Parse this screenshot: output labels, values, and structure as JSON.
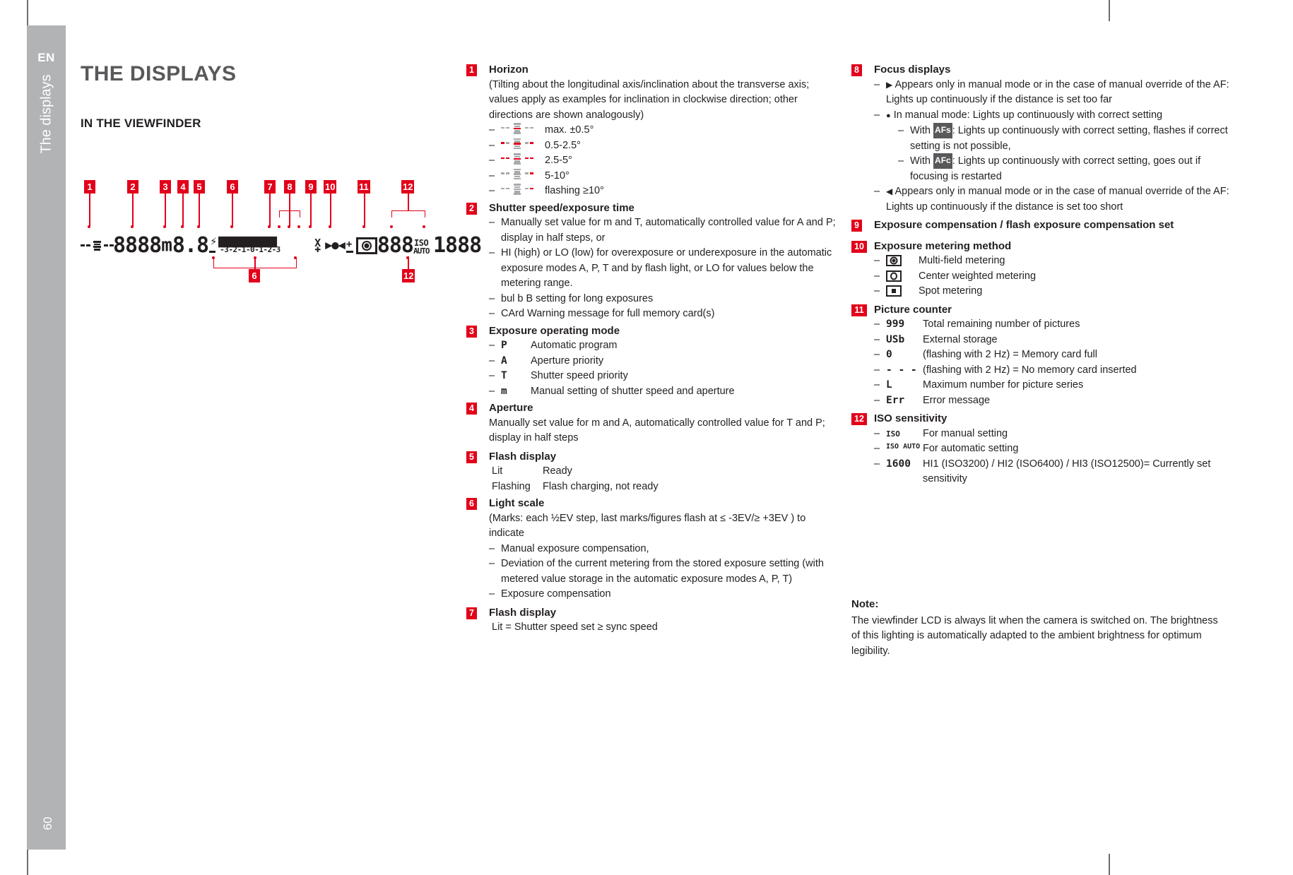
{
  "sidebar": {
    "language": "EN",
    "chapter": "The displays",
    "page_number": "60"
  },
  "headings": {
    "h1": "THE DISPLAYS",
    "h2": "IN THE VIEWFINDER"
  },
  "diagram": {
    "lcd_segments": "-- -- 8888 m 8.8 ⚡ |||||||||||| X ▶●◀ ± ◎ 888 ISO/AUTO 1888",
    "scale_ticks": "-3-2-1-0-1-2-3",
    "callouts": [
      "1",
      "2",
      "3",
      "4",
      "5",
      "6",
      "7",
      "8",
      "9",
      "10",
      "11",
      "12"
    ],
    "lower_callouts": [
      "6",
      "12"
    ]
  },
  "column1": [
    {
      "num": "1",
      "title": "Horizon",
      "intro": "(Tilting about the longitudinal axis/inclination about the transverse axis; values apply as examples for inclination in clockwise direction; other directions are shown analogously)",
      "items": [
        {
          "icon": "horizon-level-0",
          "text": "max. ±0.5°"
        },
        {
          "icon": "horizon-level-1",
          "text": "0.5-2.5°"
        },
        {
          "icon": "horizon-level-2",
          "text": "2.5-5°"
        },
        {
          "icon": "horizon-level-3",
          "text": "5-10°"
        },
        {
          "icon": "horizon-level-4",
          "text": "flashing ≥10°"
        }
      ]
    },
    {
      "num": "2",
      "title": "Shutter speed/exposure time",
      "items": [
        {
          "text": "Manually set value for m and T, automatically controlled value for A and P; display in half steps, or"
        },
        {
          "text": "HI (high) or LO (low) for overexposure or underexposure in the automatic exposure modes A, P, T and by flash light, or LO for values below the metering range."
        },
        {
          "text": "bul b B setting for long exposures"
        },
        {
          "text": "CArd Warning message for full memory card(s)"
        }
      ]
    },
    {
      "num": "3",
      "title": "Exposure operating mode",
      "items": [
        {
          "sym": "P",
          "text": "Automatic program"
        },
        {
          "sym": "A",
          "text": "Aperture priority"
        },
        {
          "sym": "T",
          "text": "Shutter speed priority"
        },
        {
          "sym": "m",
          "text": "Manual setting of shutter speed and aperture"
        }
      ]
    },
    {
      "num": "4",
      "title": "Aperture",
      "body": "Manually set value for m and A, automatically controlled value for T and P; display in half steps"
    },
    {
      "num": "5",
      "title": "Flash display",
      "rows": [
        {
          "c1": "Lit",
          "c2": "Ready"
        },
        {
          "c1": "Flashing",
          "c2": "Flash charging, not ready"
        }
      ]
    },
    {
      "num": "6",
      "title": "Light scale",
      "intro": "(Marks: each ½EV step, last marks/figures flash at ≤ -3EV/≥ +3EV ) to indicate",
      "items": [
        {
          "text": "Manual exposure compensation,"
        },
        {
          "text": "Deviation of the current metering from the stored exposure setting (with metered value storage in the automatic exposure modes A, P, T)"
        },
        {
          "text": "Exposure compensation"
        }
      ]
    },
    {
      "num": "7",
      "title": "Flash display",
      "body": "Lit = Shutter speed set ≥ sync speed"
    }
  ],
  "column2": [
    {
      "num": "8",
      "title": "Focus displays",
      "items": [
        {
          "glyph": "▶",
          "text": "Appears only in manual mode or in the case of manual override of the AF: Lights up continuously if the distance is set too far"
        },
        {
          "glyph": "●",
          "text": "In manual mode: Lights up continuously with correct setting"
        },
        {
          "glyph": "◀",
          "text": "Appears only in manual mode or in the case of manual override of the AF: Lights up continuously if the distance is set too short"
        }
      ],
      "subitems": [
        {
          "badge": "AFs",
          "text": ": Lights up continuously with correct setting, flashes if correct setting is not possible,",
          "prefix": "With "
        },
        {
          "badge": "AFc",
          "text": ": Lights up continuously with correct setting, goes out if focusing is restarted",
          "prefix": "With "
        }
      ]
    },
    {
      "num": "9",
      "title": "Exposure compensation / flash exposure compensation set"
    },
    {
      "num": "10",
      "title": "Exposure metering method",
      "items": [
        {
          "icon": "metering-multi-field",
          "text": "Multi-field metering"
        },
        {
          "icon": "metering-center-weighted",
          "text": "Center weighted metering"
        },
        {
          "icon": "metering-spot",
          "text": "Spot metering"
        }
      ]
    },
    {
      "num": "11",
      "title": "Picture counter",
      "items": [
        {
          "sym": "999",
          "text": "Total remaining number of pictures"
        },
        {
          "sym": "USb",
          "text": "External storage"
        },
        {
          "sym": "0",
          "text": "(flashing with 2 Hz) = Memory card full"
        },
        {
          "sym": "- - -",
          "text": "(flashing with 2 Hz) = No memory card inserted"
        },
        {
          "sym": "L",
          "text": "Maximum number for picture series"
        },
        {
          "sym": "Err",
          "text": "Error message"
        }
      ]
    },
    {
      "num": "12",
      "title": "ISO sensitivity",
      "items": [
        {
          "sym": "ISO",
          "text": "For manual setting"
        },
        {
          "sym": "ISO AUTO",
          "text": "For automatic setting"
        },
        {
          "sym": "1600",
          "text": "HI1 (ISO3200) / HI2 (ISO6400) / HI3 (ISO12500)= Currently set sensitivity"
        }
      ]
    }
  ],
  "note": {
    "title": "Note:",
    "text": "The viewfinder LCD is always lit when the camera is switched on. The brightness of this lighting is automatically adapted to the ambient brightness for optimum legibility."
  },
  "colors": {
    "accent_red": "#e2001a",
    "grey_tab": "#b1b3b5",
    "heading_grey": "#58595b",
    "body": "#231f20"
  }
}
